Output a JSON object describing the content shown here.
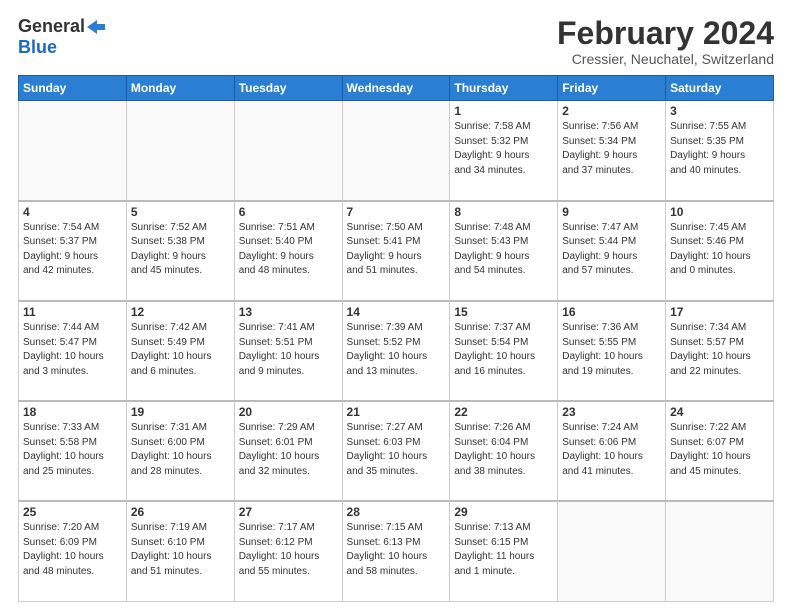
{
  "logo": {
    "general": "General",
    "blue": "Blue"
  },
  "title": "February 2024",
  "subtitle": "Cressier, Neuchatel, Switzerland",
  "days": [
    "Sunday",
    "Monday",
    "Tuesday",
    "Wednesday",
    "Thursday",
    "Friday",
    "Saturday"
  ],
  "weeks": [
    [
      {
        "day": "",
        "info": ""
      },
      {
        "day": "",
        "info": ""
      },
      {
        "day": "",
        "info": ""
      },
      {
        "day": "",
        "info": ""
      },
      {
        "day": "1",
        "info": "Sunrise: 7:58 AM\nSunset: 5:32 PM\nDaylight: 9 hours\nand 34 minutes."
      },
      {
        "day": "2",
        "info": "Sunrise: 7:56 AM\nSunset: 5:34 PM\nDaylight: 9 hours\nand 37 minutes."
      },
      {
        "day": "3",
        "info": "Sunrise: 7:55 AM\nSunset: 5:35 PM\nDaylight: 9 hours\nand 40 minutes."
      }
    ],
    [
      {
        "day": "4",
        "info": "Sunrise: 7:54 AM\nSunset: 5:37 PM\nDaylight: 9 hours\nand 42 minutes."
      },
      {
        "day": "5",
        "info": "Sunrise: 7:52 AM\nSunset: 5:38 PM\nDaylight: 9 hours\nand 45 minutes."
      },
      {
        "day": "6",
        "info": "Sunrise: 7:51 AM\nSunset: 5:40 PM\nDaylight: 9 hours\nand 48 minutes."
      },
      {
        "day": "7",
        "info": "Sunrise: 7:50 AM\nSunset: 5:41 PM\nDaylight: 9 hours\nand 51 minutes."
      },
      {
        "day": "8",
        "info": "Sunrise: 7:48 AM\nSunset: 5:43 PM\nDaylight: 9 hours\nand 54 minutes."
      },
      {
        "day": "9",
        "info": "Sunrise: 7:47 AM\nSunset: 5:44 PM\nDaylight: 9 hours\nand 57 minutes."
      },
      {
        "day": "10",
        "info": "Sunrise: 7:45 AM\nSunset: 5:46 PM\nDaylight: 10 hours\nand 0 minutes."
      }
    ],
    [
      {
        "day": "11",
        "info": "Sunrise: 7:44 AM\nSunset: 5:47 PM\nDaylight: 10 hours\nand 3 minutes."
      },
      {
        "day": "12",
        "info": "Sunrise: 7:42 AM\nSunset: 5:49 PM\nDaylight: 10 hours\nand 6 minutes."
      },
      {
        "day": "13",
        "info": "Sunrise: 7:41 AM\nSunset: 5:51 PM\nDaylight: 10 hours\nand 9 minutes."
      },
      {
        "day": "14",
        "info": "Sunrise: 7:39 AM\nSunset: 5:52 PM\nDaylight: 10 hours\nand 13 minutes."
      },
      {
        "day": "15",
        "info": "Sunrise: 7:37 AM\nSunset: 5:54 PM\nDaylight: 10 hours\nand 16 minutes."
      },
      {
        "day": "16",
        "info": "Sunrise: 7:36 AM\nSunset: 5:55 PM\nDaylight: 10 hours\nand 19 minutes."
      },
      {
        "day": "17",
        "info": "Sunrise: 7:34 AM\nSunset: 5:57 PM\nDaylight: 10 hours\nand 22 minutes."
      }
    ],
    [
      {
        "day": "18",
        "info": "Sunrise: 7:33 AM\nSunset: 5:58 PM\nDaylight: 10 hours\nand 25 minutes."
      },
      {
        "day": "19",
        "info": "Sunrise: 7:31 AM\nSunset: 6:00 PM\nDaylight: 10 hours\nand 28 minutes."
      },
      {
        "day": "20",
        "info": "Sunrise: 7:29 AM\nSunset: 6:01 PM\nDaylight: 10 hours\nand 32 minutes."
      },
      {
        "day": "21",
        "info": "Sunrise: 7:27 AM\nSunset: 6:03 PM\nDaylight: 10 hours\nand 35 minutes."
      },
      {
        "day": "22",
        "info": "Sunrise: 7:26 AM\nSunset: 6:04 PM\nDaylight: 10 hours\nand 38 minutes."
      },
      {
        "day": "23",
        "info": "Sunrise: 7:24 AM\nSunset: 6:06 PM\nDaylight: 10 hours\nand 41 minutes."
      },
      {
        "day": "24",
        "info": "Sunrise: 7:22 AM\nSunset: 6:07 PM\nDaylight: 10 hours\nand 45 minutes."
      }
    ],
    [
      {
        "day": "25",
        "info": "Sunrise: 7:20 AM\nSunset: 6:09 PM\nDaylight: 10 hours\nand 48 minutes."
      },
      {
        "day": "26",
        "info": "Sunrise: 7:19 AM\nSunset: 6:10 PM\nDaylight: 10 hours\nand 51 minutes."
      },
      {
        "day": "27",
        "info": "Sunrise: 7:17 AM\nSunset: 6:12 PM\nDaylight: 10 hours\nand 55 minutes."
      },
      {
        "day": "28",
        "info": "Sunrise: 7:15 AM\nSunset: 6:13 PM\nDaylight: 10 hours\nand 58 minutes."
      },
      {
        "day": "29",
        "info": "Sunrise: 7:13 AM\nSunset: 6:15 PM\nDaylight: 11 hours\nand 1 minute."
      },
      {
        "day": "",
        "info": ""
      },
      {
        "day": "",
        "info": ""
      }
    ]
  ]
}
